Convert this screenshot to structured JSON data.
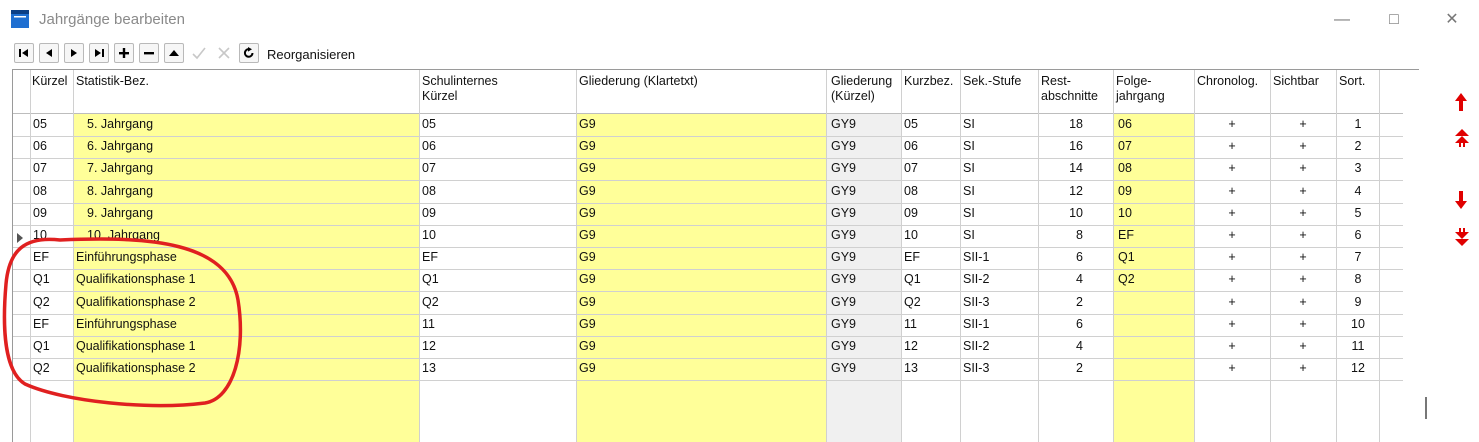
{
  "window": {
    "title": "Jahrgänge bearbeiten",
    "icons": [
      "app-window-icon",
      "minimize-icon",
      "maximize-icon",
      "close-icon"
    ]
  },
  "toolbar": {
    "reorg_label": "Reorganisieren",
    "icons": [
      "first-record-icon",
      "prev-record-icon",
      "next-record-icon",
      "last-record-icon",
      "add-icon",
      "delete-icon",
      "edit-icon",
      "post-icon",
      "cancel-icon",
      "refresh-icon"
    ]
  },
  "columns": [
    {
      "l1": "",
      "l2": "Kürzel"
    },
    {
      "l1": "",
      "l2": "Statistik-Bez."
    },
    {
      "l1": "Schulinternes",
      "l2": "Kürzel"
    },
    {
      "l1": "",
      "l2": "Gliederung (Klartetxt)"
    },
    {
      "l1": "Gliederung",
      "l2": "(Kürzel)"
    },
    {
      "l1": "",
      "l2": "Kurzbez."
    },
    {
      "l1": "",
      "l2": "Sek.-Stufe"
    },
    {
      "l1": "Rest-",
      "l2": "abschnitte"
    },
    {
      "l1": "Folge-",
      "l2": "jahrgang"
    },
    {
      "l1": "",
      "l2": "Chronolog."
    },
    {
      "l1": "",
      "l2": "Sichtbar"
    },
    {
      "l1": "",
      "l2": "Sort."
    }
  ],
  "rows": [
    [
      "05",
      "5. Jahrgang",
      "05",
      "G9",
      "GY9",
      "05",
      "SI",
      "18",
      "06",
      "+",
      "+",
      "1"
    ],
    [
      "06",
      "6. Jahrgang",
      "06",
      "G9",
      "GY9",
      "06",
      "SI",
      "16",
      "07",
      "+",
      "+",
      "2"
    ],
    [
      "07",
      "7. Jahrgang",
      "07",
      "G9",
      "GY9",
      "07",
      "SI",
      "14",
      "08",
      "+",
      "+",
      "3"
    ],
    [
      "08",
      "8. Jahrgang",
      "08",
      "G9",
      "GY9",
      "08",
      "SI",
      "12",
      "09",
      "+",
      "+",
      "4"
    ],
    [
      "09",
      "9. Jahrgang",
      "09",
      "G9",
      "GY9",
      "09",
      "SI",
      "10",
      "10",
      "+",
      "+",
      "5"
    ],
    [
      "10",
      "10. Jahrgang",
      "10",
      "G9",
      "GY9",
      "10",
      "SI",
      "8",
      "EF",
      "+",
      "+",
      "6"
    ],
    [
      "EF",
      "Einführungsphase",
      "EF",
      "G9",
      "GY9",
      "EF",
      "SII-1",
      "6",
      "Q1",
      "+",
      "+",
      "7"
    ],
    [
      "Q1",
      "Qualifikationsphase 1",
      "Q1",
      "G9",
      "GY9",
      "Q1",
      "SII-2",
      "4",
      "Q2",
      "+",
      "+",
      "8"
    ],
    [
      "Q2",
      "Qualifikationsphase 2",
      "Q2",
      "G9",
      "GY9",
      "Q2",
      "SII-3",
      "2",
      "",
      "+",
      "+",
      "9"
    ],
    [
      "EF",
      "Einführungsphase",
      "11",
      "G9",
      "GY9",
      "11",
      "SII-1",
      "6",
      "",
      "+",
      "+",
      "10"
    ],
    [
      "Q1",
      "Qualifikationsphase 1",
      "12",
      "G9",
      "GY9",
      "12",
      "SII-2",
      "4",
      "",
      "+",
      "+",
      "11"
    ],
    [
      "Q2",
      "Qualifikationsphase 2",
      "13",
      "G9",
      "GY9",
      "13",
      "SII-3",
      "2",
      "",
      "+",
      "+",
      "12"
    ]
  ],
  "side_controls": [
    "move-up-icon",
    "move-top-icon",
    "move-down-icon",
    "move-bottom-icon"
  ],
  "colors": {
    "editable_yellow": "#ffff99",
    "readonly_gray": "#f0f0f0",
    "arrow_red": "#e00000",
    "annotation_red": "#e02020"
  }
}
